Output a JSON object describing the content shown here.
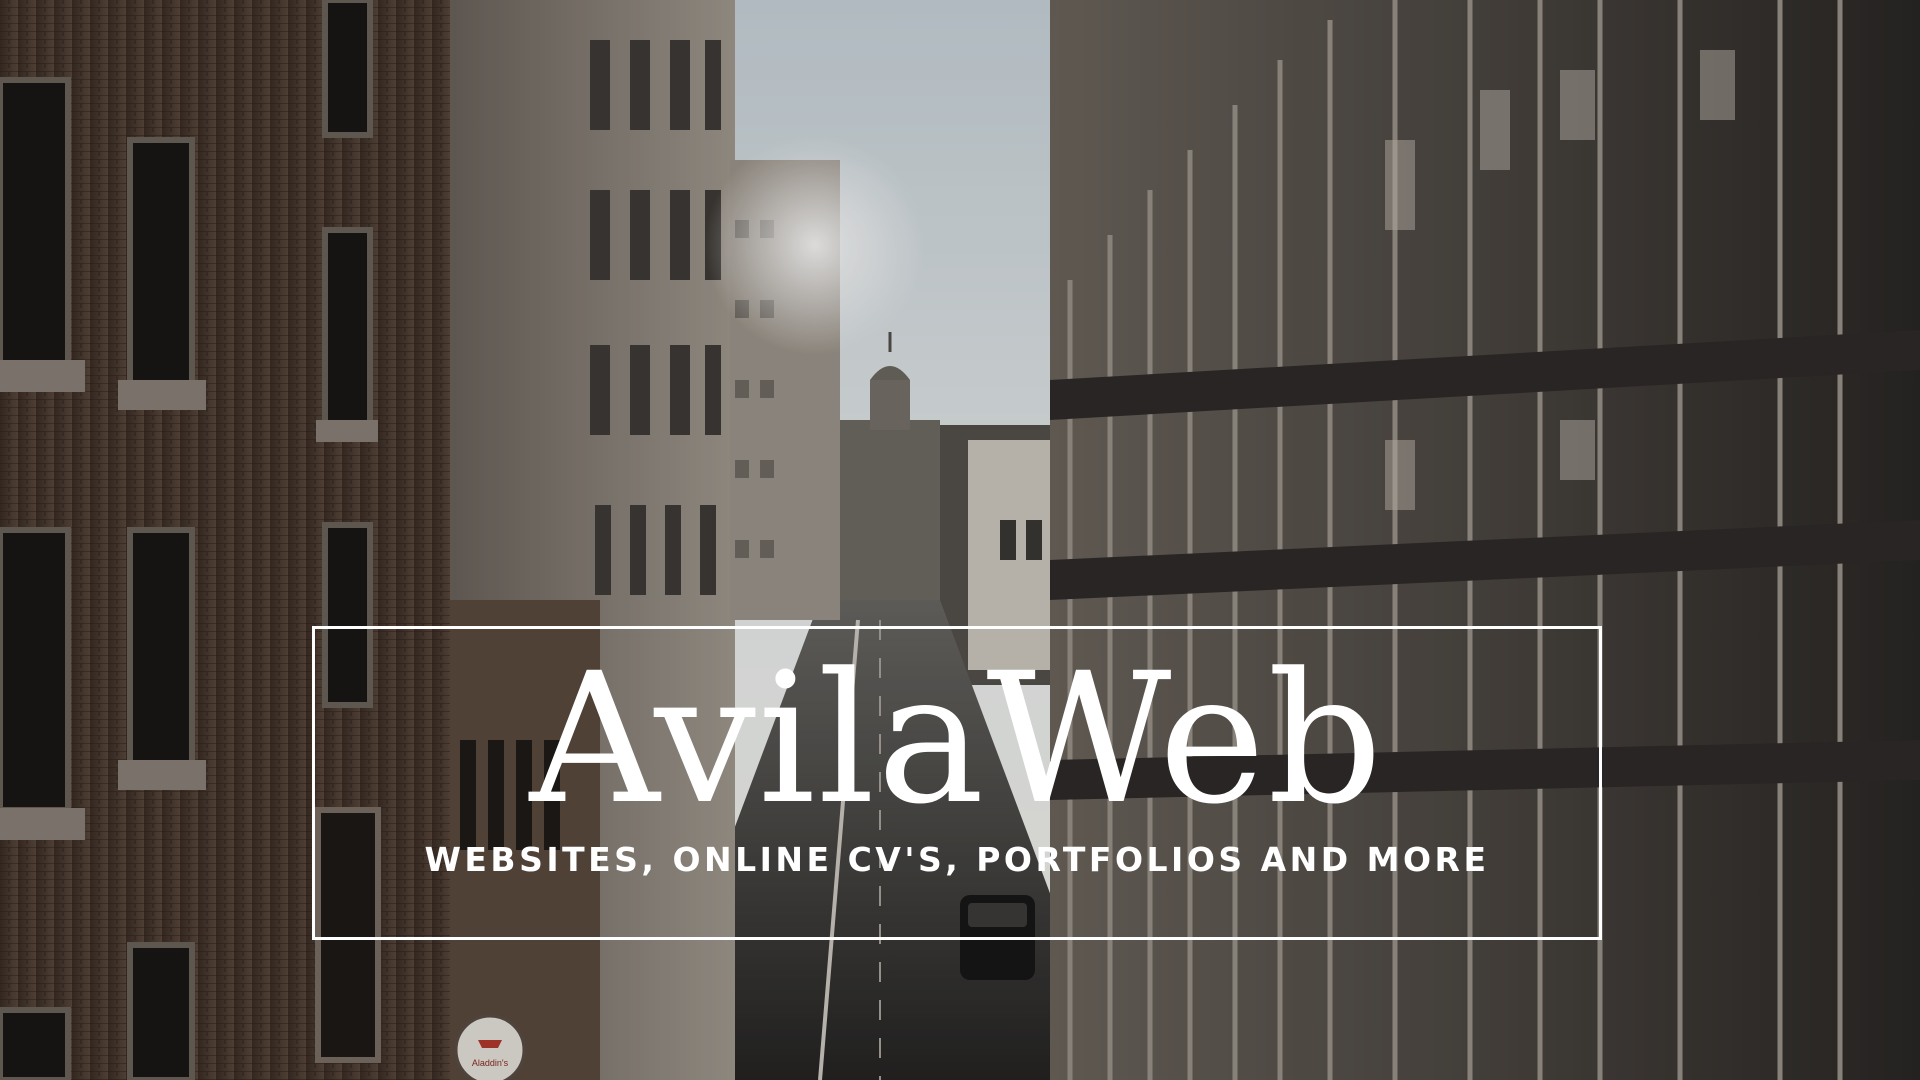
{
  "hero": {
    "brand": "AvilaWeb",
    "tagline": "WEBSITES, ONLINE CV'S, PORTFOLIOS AND MORE"
  },
  "backdrop": {
    "signage_text": "Aladdin's"
  },
  "colors": {
    "text": "#ffffff",
    "frame": "#ffffff",
    "sky": "#dfe6ea",
    "brick": "#4a3a30",
    "concrete": "#7a7470",
    "glass": "#3b3835"
  }
}
